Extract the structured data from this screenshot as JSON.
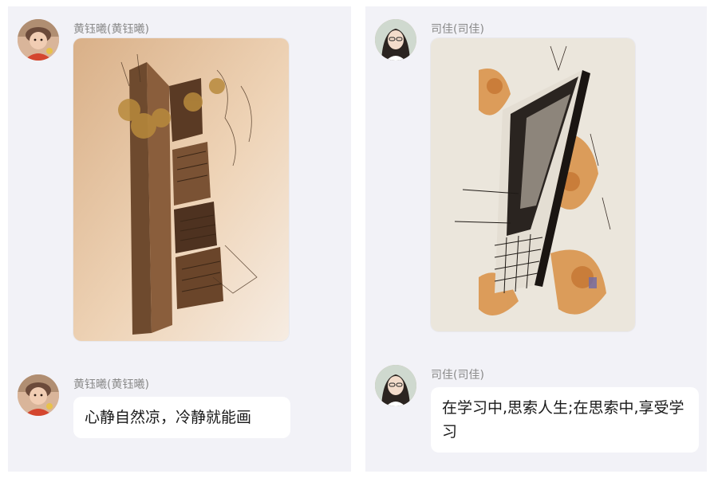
{
  "conversation_left": {
    "sender_name": "黄钰曦(黄钰曦)",
    "photo_message": {
      "content": "pen-and-marker architectural perspective sketch on sepia paper"
    },
    "text_message": "心静自然凉，冷静就能画"
  },
  "conversation_right": {
    "sender_name": "司佳(司佳)",
    "photo_message": {
      "content": "ink sketch of angular modern building with orange watercolor wash"
    },
    "text_message": "在学习中,思索人生;在思索中,享受学习"
  },
  "colors": {
    "panel_background": "#f2f2f7",
    "bubble_background": "#ffffff",
    "sender_name": "#8a8a8a",
    "message_text": "#1a1a1a"
  }
}
